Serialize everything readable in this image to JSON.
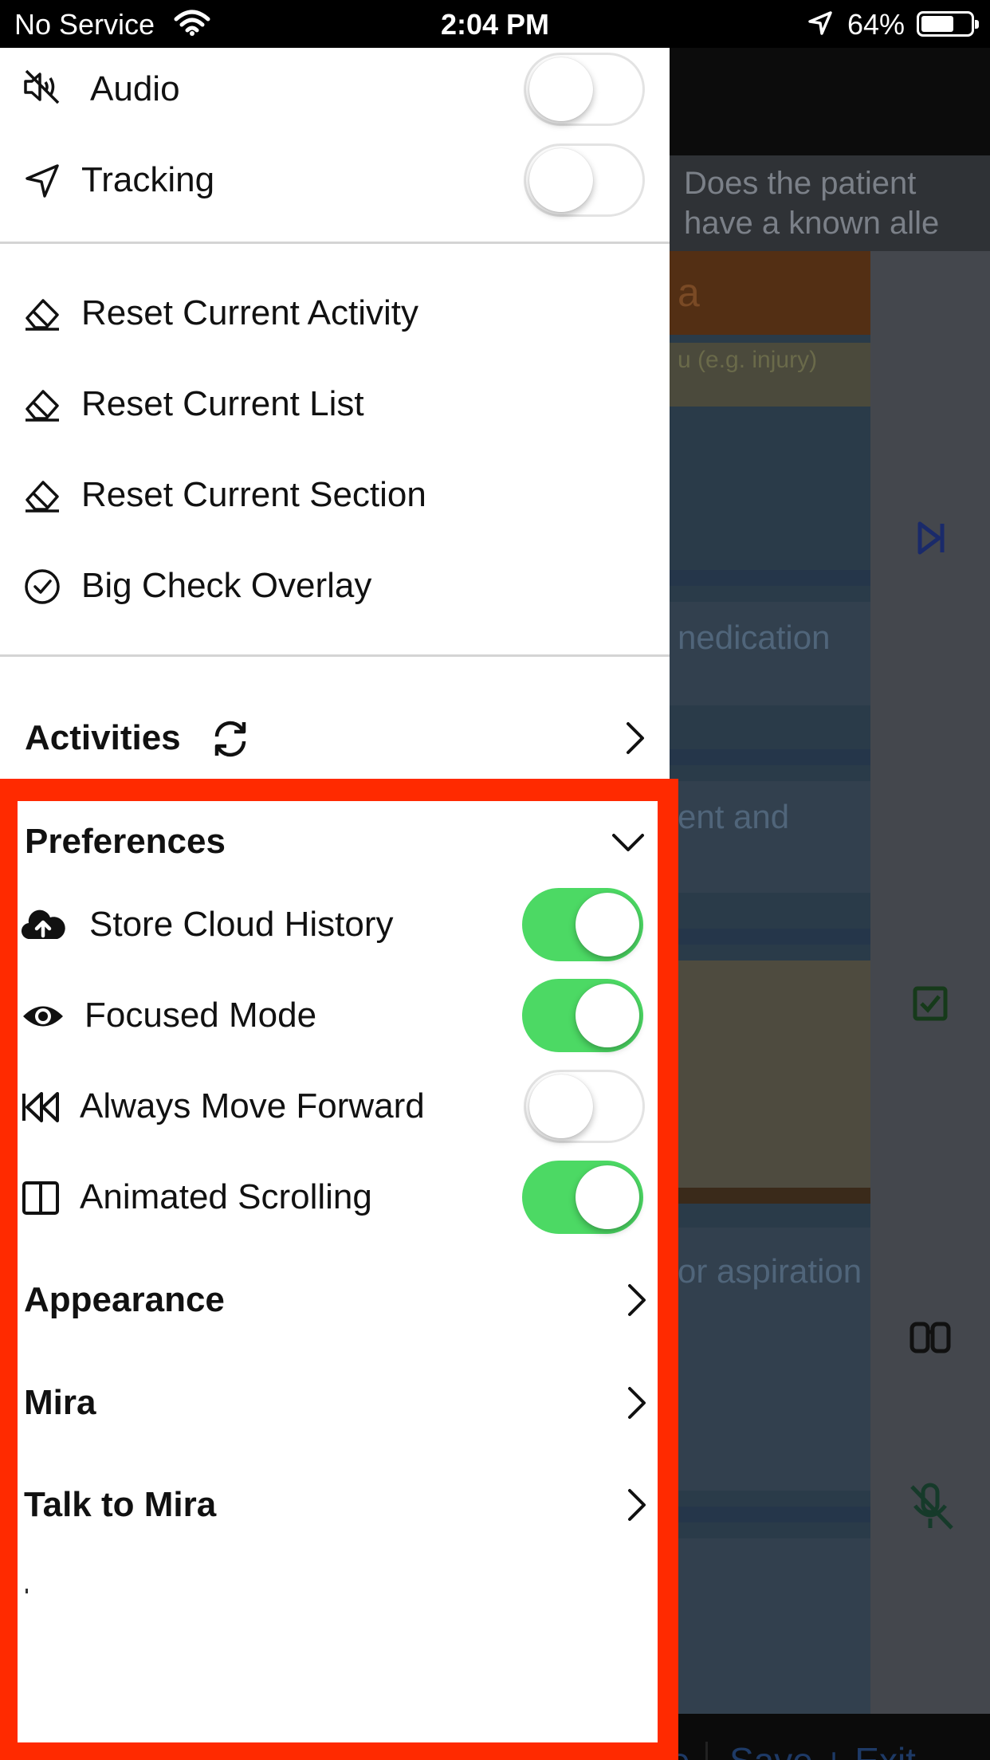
{
  "status_bar": {
    "carrier": "No Service",
    "time": "2:04 PM",
    "battery_percent": "64%",
    "battery_level": 0.64,
    "icons": [
      "wifi-icon",
      "location-arrow-icon",
      "battery-icon"
    ]
  },
  "background_app": {
    "question_text": "Does the patient have a known alle",
    "cards": [
      {
        "text": "a"
      },
      {
        "text": "u (e.g. injury)"
      },
      {
        "text": "nedication"
      },
      {
        "text": "ent and"
      },
      {
        "text": "or aspiration"
      }
    ],
    "footer_label": "Save + Exit",
    "footer_partial": "e",
    "rail_icons": [
      "skip-forward-icon",
      "checkbox-icon",
      "binoculars-icon",
      "microphone-off-icon"
    ]
  },
  "drawer": {
    "toggles_top": [
      {
        "label": "Audio",
        "icon": "audio-off-icon",
        "on": false
      },
      {
        "label": "Tracking",
        "icon": "location-arrow-icon",
        "on": false
      }
    ],
    "actions": [
      {
        "label": "Reset Current Activity",
        "icon": "eraser-icon"
      },
      {
        "label": "Reset Current List",
        "icon": "eraser-icon"
      },
      {
        "label": "Reset Current Section",
        "icon": "eraser-icon"
      },
      {
        "label": "Big Check Overlay",
        "icon": "check-circle-icon"
      }
    ],
    "activities": {
      "label": "Activities",
      "icon": "sync-icon"
    },
    "preferences": {
      "label": "Preferences",
      "toggles": [
        {
          "label": "Store Cloud History",
          "icon": "cloud-upload-icon",
          "on": true
        },
        {
          "label": "Focused Mode",
          "icon": "eye-icon",
          "on": true
        },
        {
          "label": "Always Move Forward",
          "icon": "rewind-icon",
          "on": false
        },
        {
          "label": "Animated Scrolling",
          "icon": "columns-icon",
          "on": true
        }
      ]
    },
    "menu": [
      {
        "label": "Appearance"
      },
      {
        "label": "Mira"
      },
      {
        "label": "Talk to Mira"
      }
    ]
  },
  "colors": {
    "toggle_on": "#4cd964",
    "highlight": "#ff2a00"
  }
}
